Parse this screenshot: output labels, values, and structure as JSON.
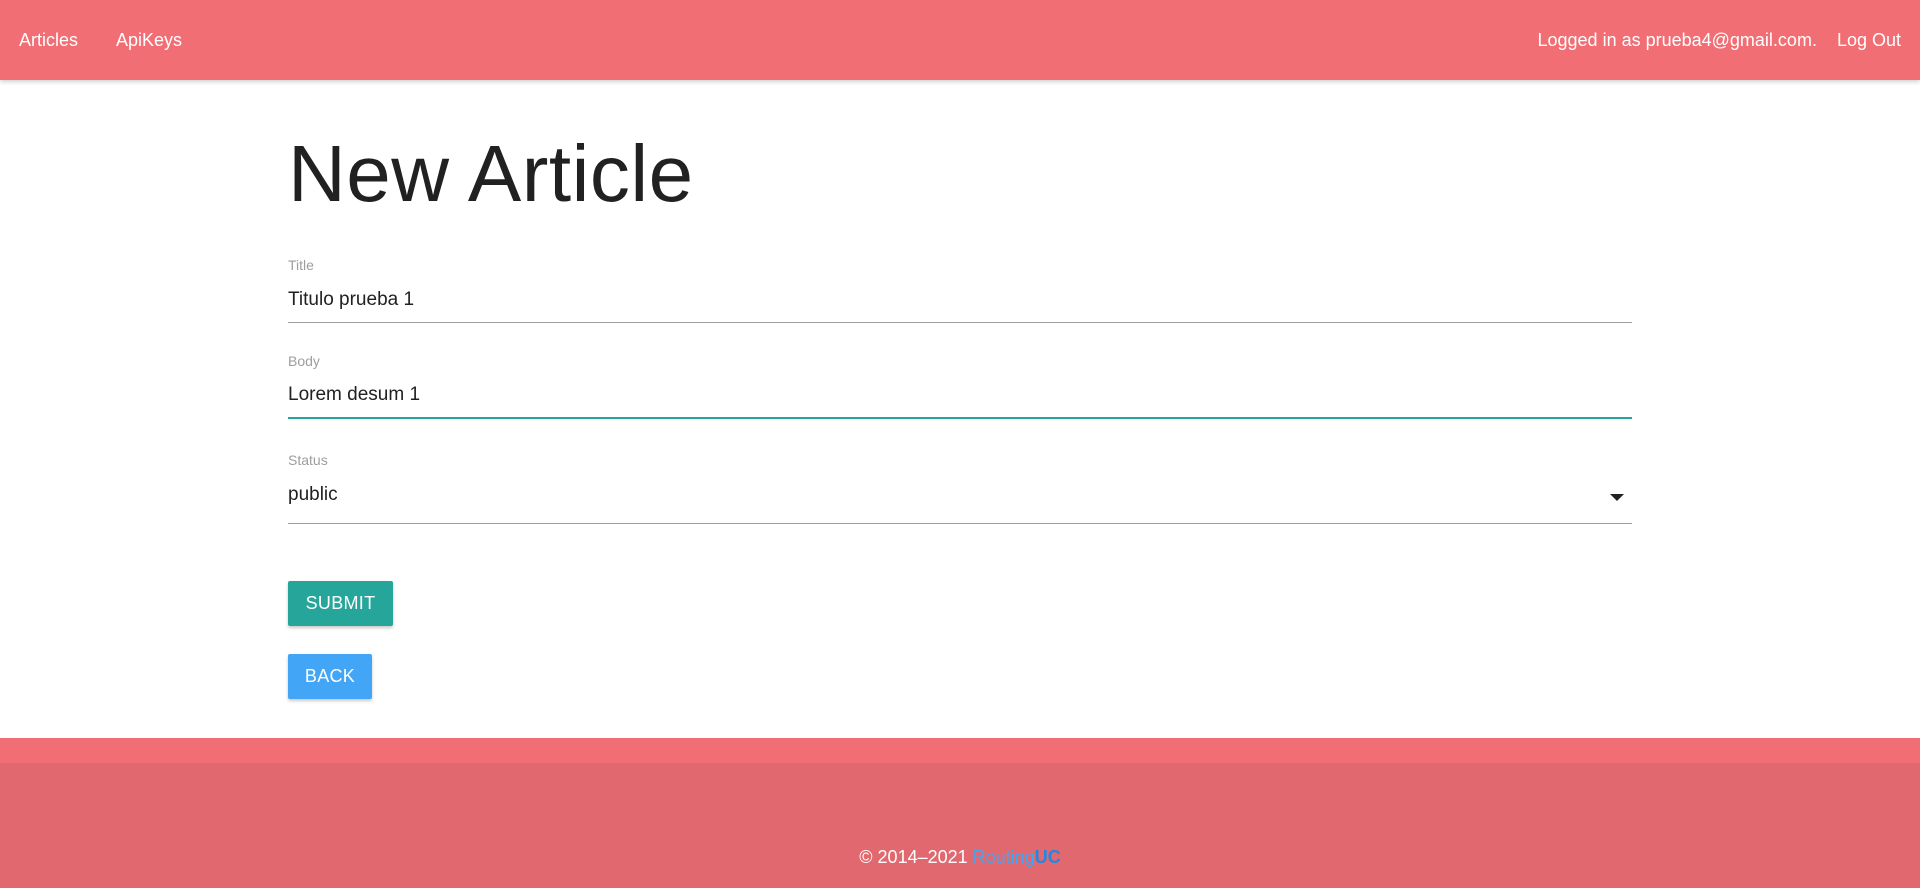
{
  "nav": {
    "links": [
      "Articles",
      "ApiKeys"
    ],
    "logged_in_text": "Logged in as prueba4@gmail.com.",
    "logout_label": "Log Out"
  },
  "page": {
    "title": "New Article"
  },
  "form": {
    "title_label": "Title",
    "title_value": "Titulo prueba 1",
    "body_label": "Body",
    "body_value": "Lorem desum 1",
    "status_label": "Status",
    "status_value": "public",
    "submit_label": "SUBMIT",
    "back_label": "BACK"
  },
  "footer": {
    "copyright": "© 2014–2021 ",
    "brand_part1": "Routing",
    "brand_part2": "UC"
  },
  "colors": {
    "navbar": "#f06e74",
    "footer": "#e0686e",
    "submit": "#26a69a",
    "back": "#42a5f5",
    "focus_underline": "#26a69a"
  }
}
